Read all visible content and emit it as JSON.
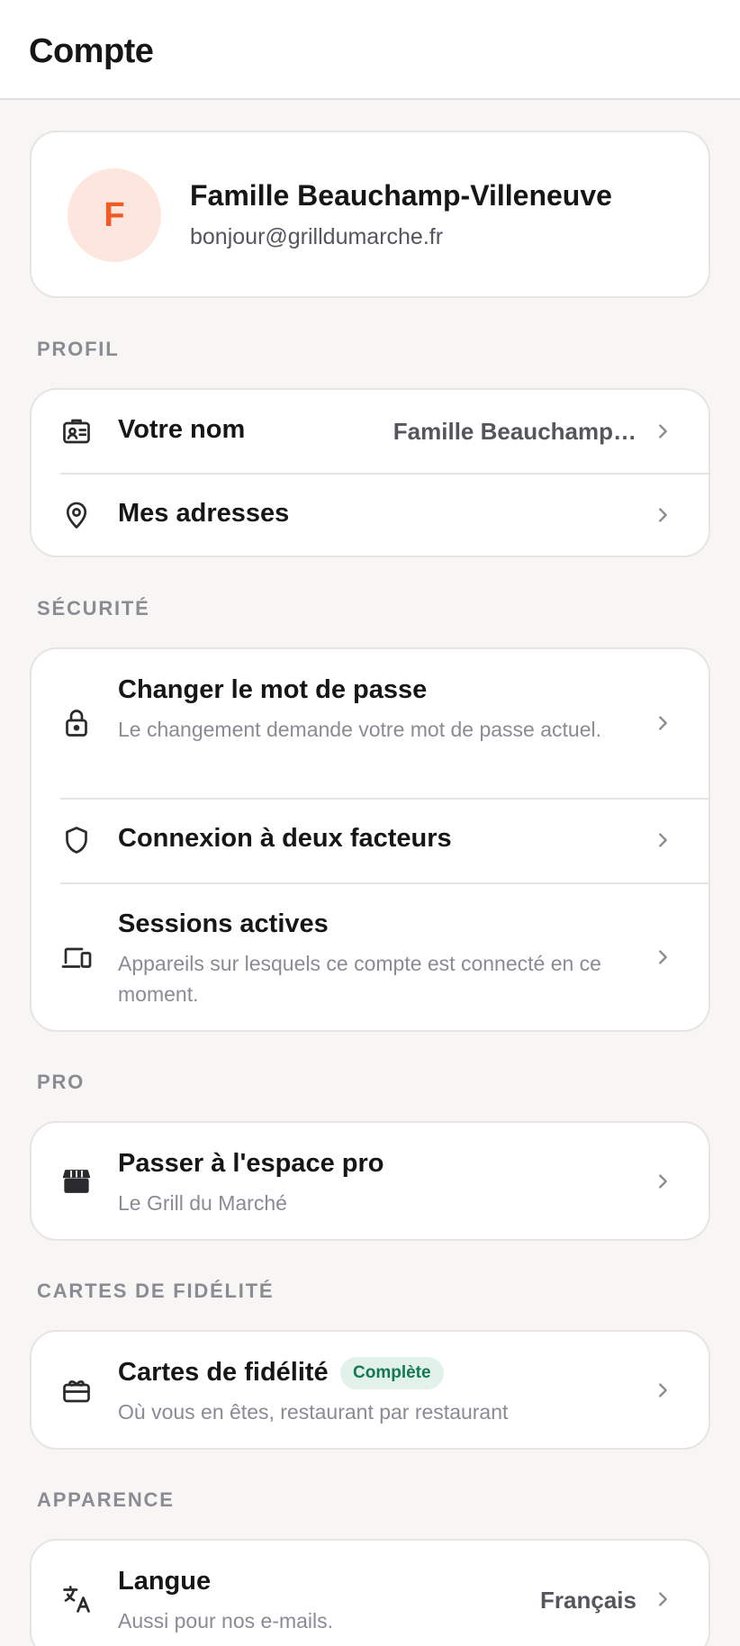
{
  "header": {
    "title": "Compte"
  },
  "profile": {
    "initial": "F",
    "name": "Famille Beauchamp-Villeneuve",
    "email": "bonjour@grilldumarche.fr"
  },
  "sections": {
    "profil": {
      "label": "PROFIL",
      "items": [
        {
          "title": "Votre nom",
          "value": "Famille Beauchamp…",
          "icon": "id-card-icon"
        },
        {
          "title": "Mes adresses",
          "icon": "map-pin-icon"
        }
      ]
    },
    "securite": {
      "label": "SÉCURITÉ",
      "items": [
        {
          "title": "Changer le mot de passe",
          "subtitle": "Le changement demande votre mot de passe actuel.",
          "icon": "lock-icon"
        },
        {
          "title": "Connexion à deux facteurs",
          "icon": "shield-icon"
        },
        {
          "title": "Sessions actives",
          "subtitle": "Appareils sur lesquels ce compte est connecté en ce moment.",
          "icon": "devices-icon"
        }
      ]
    },
    "pro": {
      "label": "PRO",
      "items": [
        {
          "title": "Passer à l'espace pro",
          "subtitle": "Le Grill du Marché",
          "icon": "storefront-icon"
        }
      ]
    },
    "fidelite": {
      "label": "CARTES DE FIDÉLITÉ",
      "items": [
        {
          "title": "Cartes de fidélité",
          "badge": "Complète",
          "subtitle": "Où vous en êtes, restaurant par restaurant",
          "icon": "gift-card-icon"
        }
      ]
    },
    "apparence": {
      "label": "APPARENCE",
      "items": [
        {
          "title": "Langue",
          "subtitle": "Aussi pour nos e-mails.",
          "value": "Français",
          "icon": "translate-icon"
        }
      ]
    }
  },
  "colors": {
    "accent": "#f15a22",
    "avatar_bg": "#fde6dd",
    "badge_bg": "#e2f1ea",
    "badge_text": "#117a52",
    "page_bg": "#f7f6f4"
  }
}
